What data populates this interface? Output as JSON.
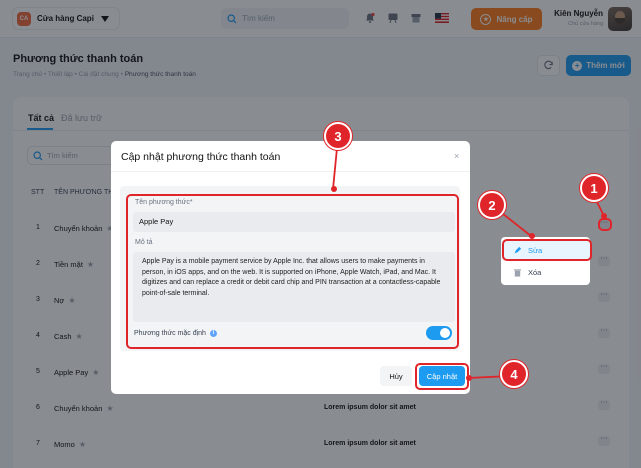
{
  "topbar": {
    "store_logo": "CA",
    "store_name": "Cửa hàng Capi",
    "search_placeholder": "Tìm kiếm",
    "upgrade_label": "Nâng cấp",
    "user_name": "Kiên Nguyễn",
    "user_role": "Chủ cửa hàng",
    "icons": [
      "bell-icon",
      "board-icon",
      "storefront-icon",
      "flag-us-icon"
    ]
  },
  "page": {
    "title": "Phương thức thanh toán",
    "breadcrumb": [
      "Trang chủ",
      "Thiết lập",
      "Cài đặt chung",
      "Phương thức thanh toán"
    ],
    "breadcrumb_sep": "•",
    "add_label": "Thêm mới"
  },
  "tabs": {
    "all": "Tất cả",
    "saved": "Đã lưu trữ"
  },
  "list": {
    "search_placeholder": "Tìm kiếm",
    "headers": {
      "stt": "STT",
      "name": "TÊN PHƯƠNG TH"
    },
    "rows": [
      {
        "stt": "1",
        "name": "Chuyển khoản",
        "desc": ""
      },
      {
        "stt": "2",
        "name": "Tiền mặt",
        "desc": ""
      },
      {
        "stt": "3",
        "name": "Nợ",
        "desc": ""
      },
      {
        "stt": "4",
        "name": "Cash",
        "desc": ""
      },
      {
        "stt": "5",
        "name": "Apple Pay",
        "desc": ""
      },
      {
        "stt": "6",
        "name": "Chuyển khoản",
        "desc": "Lorem ipsum dolor sit amet"
      },
      {
        "stt": "7",
        "name": "Momo",
        "desc": "Lorem ipsum dolor sit amet"
      }
    ],
    "more_label": "···"
  },
  "menu": {
    "edit_label": "Sửa",
    "delete_label": "Xóa"
  },
  "modal": {
    "title": "Cập nhật phương thức thanh toán",
    "close_label": "×",
    "name_label": "Tên phương thức*",
    "name_value": "Apple Pay",
    "desc_label": "Mô tả",
    "desc_value": "Apple Pay is a mobile payment service by Apple Inc. that allows users to make payments in person, in iOS apps, and on the web. It is supported on iPhone, Apple Watch, iPad, and Mac. It digitizes and can replace a credit or debit card chip and PIN transaction at a contactless-capable point-of-sale terminal.",
    "default_label": "Phương thức mặc định",
    "default_on": true,
    "cancel_label": "Hủy",
    "update_label": "Cập nhật"
  },
  "annotations": {
    "steps": [
      "1",
      "2",
      "3",
      "4"
    ],
    "color": "#e0252a"
  },
  "colors": {
    "accent": "#1d9bf0",
    "upgrade": "#ff7a1a",
    "brand": "#f26b3a"
  }
}
